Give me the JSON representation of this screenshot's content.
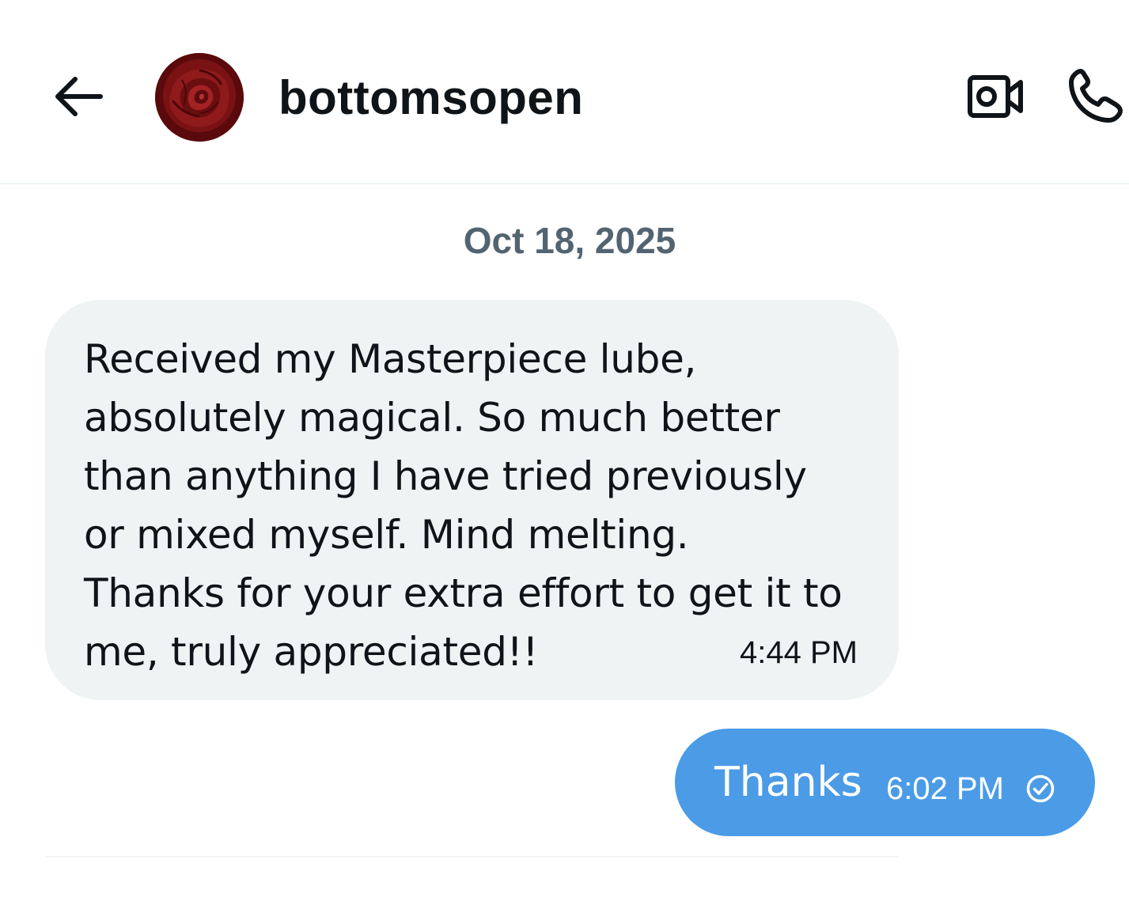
{
  "header": {
    "username": "bottomsopen",
    "avatar_icon": "rose-avatar",
    "back_icon": "arrow-left-icon",
    "video_icon": "video-camera-icon",
    "call_icon": "phone-icon"
  },
  "conversation": {
    "date_divider": "Oct 18, 2025",
    "messages": [
      {
        "direction": "incoming",
        "text": "Received my Masterpiece lube,\nabsolutely magical. So much better\nthan anything I have tried previously\nor mixed myself. Mind melting.\nThanks for your extra effort to get it to\nme, truly appreciated!!",
        "time": "4:44 PM"
      },
      {
        "direction": "outgoing",
        "text": "Thanks",
        "time": "6:02 PM",
        "status_icon": "check-circle-icon"
      }
    ]
  },
  "colors": {
    "incoming_bubble": "#eff3f4",
    "outgoing_bubble": "#4b9be7",
    "secondary_text": "#536471",
    "primary_text": "#0f1419"
  }
}
